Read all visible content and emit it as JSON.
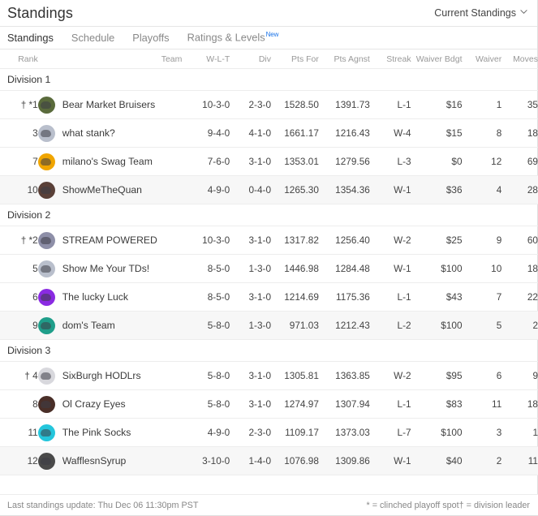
{
  "header": {
    "title": "Standings",
    "select_label": "Current Standings",
    "chevron_icon": "chevron-down-icon"
  },
  "tabs": [
    {
      "label": "Standings",
      "active": true,
      "badge": ""
    },
    {
      "label": "Schedule",
      "active": false,
      "badge": ""
    },
    {
      "label": "Playoffs",
      "active": false,
      "badge": ""
    },
    {
      "label": "Ratings & Levels",
      "active": false,
      "badge": "New"
    }
  ],
  "columns": [
    "Rank",
    "Team",
    "W-L-T",
    "Div",
    "Pts For",
    "Pts Agnst",
    "Streak",
    "Waiver Bdgt",
    "Waiver",
    "Moves"
  ],
  "divisions": [
    {
      "name": "Division 1",
      "teams": [
        {
          "rank": "† *1",
          "team": "Bear Market Bruisers",
          "wlt": "10-3-0",
          "div": "2-3-0",
          "pts_for": "1528.50",
          "pts_agnst": "1391.73",
          "streak": "L-1",
          "waiver_bdgt": "$16",
          "waiver": "1",
          "moves": "35",
          "avatar_color": "#5a6b3c",
          "avatar_icon": "team-avatar-bear"
        },
        {
          "rank": "3",
          "team": "what stank?",
          "wlt": "9-4-0",
          "div": "4-1-0",
          "pts_for": "1661.17",
          "pts_agnst": "1216.43",
          "streak": "W-4",
          "waiver_bdgt": "$15",
          "waiver": "8",
          "moves": "18",
          "avatar_color": "#b9bfcc",
          "avatar_icon": "team-avatar-helmet"
        },
        {
          "rank": "7",
          "team": "milano's Swag Team",
          "wlt": "7-6-0",
          "div": "3-1-0",
          "pts_for": "1353.01",
          "pts_agnst": "1279.56",
          "streak": "L-3",
          "waiver_bdgt": "$0",
          "waiver": "12",
          "moves": "69",
          "avatar_color": "#f0a500",
          "avatar_icon": "team-avatar-helmet-purple"
        },
        {
          "rank": "10",
          "team": "ShowMeTheQuan",
          "wlt": "4-9-0",
          "div": "0-4-0",
          "pts_for": "1265.30",
          "pts_agnst": "1354.36",
          "streak": "W-1",
          "waiver_bdgt": "$36",
          "waiver": "4",
          "moves": "28",
          "avatar_color": "#5a4038",
          "avatar_icon": "team-avatar-photo"
        }
      ]
    },
    {
      "name": "Division 2",
      "teams": [
        {
          "rank": "† *2",
          "team": "STREAM POWERED",
          "wlt": "10-3-0",
          "div": "3-1-0",
          "pts_for": "1317.82",
          "pts_agnst": "1256.40",
          "streak": "W-2",
          "waiver_bdgt": "$25",
          "waiver": "9",
          "moves": "60",
          "avatar_color": "#8e8fa8",
          "avatar_icon": "team-avatar-horse"
        },
        {
          "rank": "5",
          "team": "Show Me Your TDs!",
          "wlt": "8-5-0",
          "div": "1-3-0",
          "pts_for": "1446.98",
          "pts_agnst": "1284.48",
          "streak": "W-1",
          "waiver_bdgt": "$100",
          "waiver": "10",
          "moves": "18",
          "avatar_color": "#b9bfcc",
          "avatar_icon": "team-avatar-helmet"
        },
        {
          "rank": "6",
          "team": "The lucky Luck",
          "wlt": "8-5-0",
          "div": "3-1-0",
          "pts_for": "1214.69",
          "pts_agnst": "1175.36",
          "streak": "L-1",
          "waiver_bdgt": "$43",
          "waiver": "7",
          "moves": "22",
          "avatar_color": "#8a2be2",
          "avatar_icon": "team-avatar-helmet-violet"
        },
        {
          "rank": "9",
          "team": "dom's Team",
          "wlt": "5-8-0",
          "div": "1-3-0",
          "pts_for": "971.03",
          "pts_agnst": "1212.43",
          "streak": "L-2",
          "waiver_bdgt": "$100",
          "waiver": "5",
          "moves": "2",
          "avatar_color": "#1f9e8a",
          "avatar_icon": "team-avatar-helmet-red"
        }
      ]
    },
    {
      "name": "Division 3",
      "teams": [
        {
          "rank": "† 4",
          "team": "SixBurgh HODLrs",
          "wlt": "5-8-0",
          "div": "3-1-0",
          "pts_for": "1305.81",
          "pts_agnst": "1363.85",
          "streak": "W-2",
          "waiver_bdgt": "$95",
          "waiver": "6",
          "moves": "9",
          "avatar_color": "#d8d8dd",
          "avatar_icon": "team-avatar-helmet-gold"
        },
        {
          "rank": "8",
          "team": "Ol Crazy Eyes",
          "wlt": "5-8-0",
          "div": "3-1-0",
          "pts_for": "1274.97",
          "pts_agnst": "1307.94",
          "streak": "L-1",
          "waiver_bdgt": "$83",
          "waiver": "11",
          "moves": "18",
          "avatar_color": "#4a2f28",
          "avatar_icon": "team-avatar-photo"
        },
        {
          "rank": "11",
          "team": "The Pink Socks",
          "wlt": "4-9-0",
          "div": "2-3-0",
          "pts_for": "1109.17",
          "pts_agnst": "1373.03",
          "streak": "L-7",
          "waiver_bdgt": "$100",
          "waiver": "3",
          "moves": "1",
          "avatar_color": "#24c6dc",
          "avatar_icon": "team-avatar-helmet-pink"
        },
        {
          "rank": "12",
          "team": "WafflesnSyrup",
          "wlt": "3-10-0",
          "div": "1-4-0",
          "pts_for": "1076.98",
          "pts_agnst": "1309.86",
          "streak": "W-1",
          "waiver_bdgt": "$40",
          "waiver": "2",
          "moves": "11",
          "avatar_color": "#4a4a4a",
          "avatar_icon": "team-avatar-helmet-dark"
        }
      ]
    }
  ],
  "footer": {
    "last_update": "Last standings update: Thu Dec 06 11:30pm PST",
    "legend_clinched": "* = clinched playoff spot",
    "legend_division": "† = division leader"
  }
}
